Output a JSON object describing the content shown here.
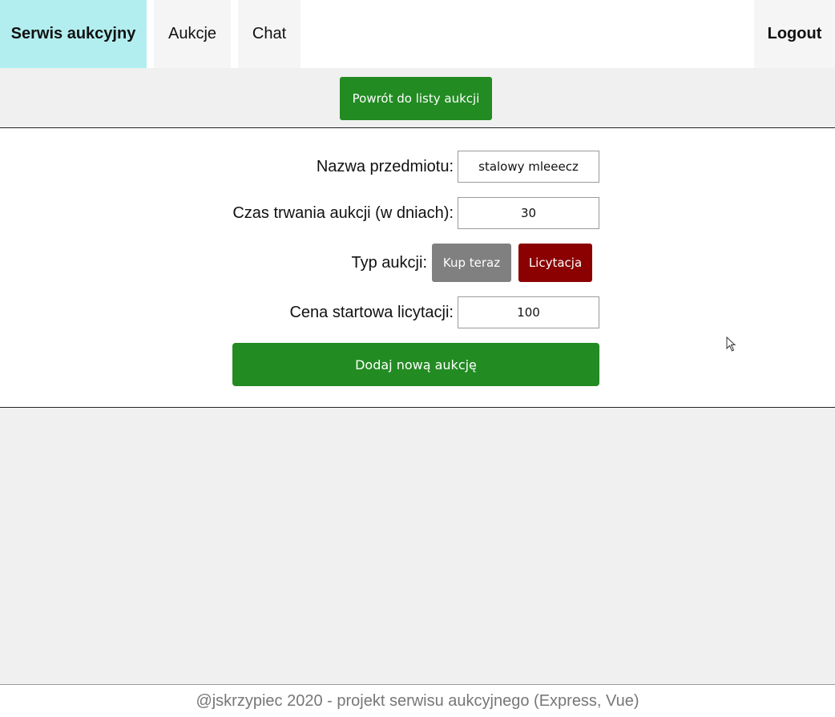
{
  "nav": {
    "brand": "Serwis aukcyjny",
    "items": [
      {
        "label": "Aukcje"
      },
      {
        "label": "Chat"
      }
    ],
    "logout": "Logout"
  },
  "back_button": "Powrót do listy aukcji",
  "form": {
    "item_name": {
      "label": "Nazwa przedmiotu:",
      "value": "stalowy mleeecz"
    },
    "duration": {
      "label": "Czas trwania aukcji (w dniach):",
      "value": "30"
    },
    "type": {
      "label": "Typ aukcji:",
      "options": [
        {
          "label": "Kup teraz",
          "color": "#808080"
        },
        {
          "label": "Licytacja",
          "color": "#8b0000"
        }
      ]
    },
    "start_price": {
      "label": "Cena startowa licytacji:",
      "value": "100"
    },
    "submit": "Dodaj nową aukcję"
  },
  "footer": "@jskrzypiec 2020 - projekt serwisu aukcyjnego (Express, Vue)",
  "colors": {
    "brand_bg": "#b2eef0",
    "primary_button": "#228b22",
    "page_bg": "#f0f0f0"
  },
  "icons": {
    "cursor": "mouse-pointer-icon"
  }
}
